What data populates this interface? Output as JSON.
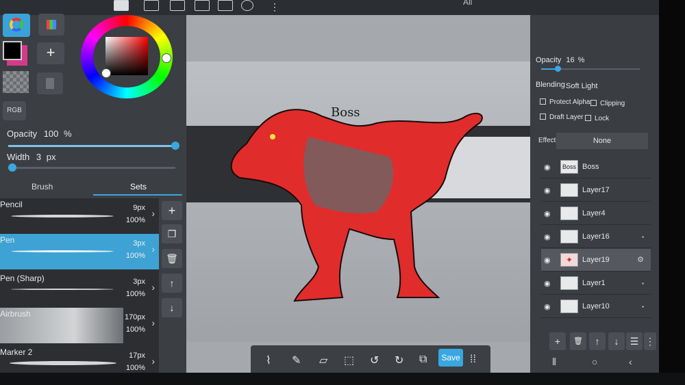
{
  "topbar": {
    "title": "All",
    "more": "⋮"
  },
  "color": {
    "primary": "#000000",
    "secondary": "#d43a8a",
    "wheel_selected": "#cc2f36",
    "rgb_label": "RGB",
    "add_label": "+"
  },
  "brush_panel": {
    "opacity_label": "Opacity",
    "opacity_value": "100",
    "opacity_unit": "%",
    "opacity_fraction": 1.0,
    "width_label": "Width",
    "width_value": "3",
    "width_unit": "px",
    "width_fraction": 0.02,
    "tabs": [
      {
        "label": "Brush"
      },
      {
        "label": "Sets"
      }
    ],
    "active_tab": "Sets",
    "brushes": [
      {
        "name": "Pencil",
        "size": "9px",
        "opacity": "100%"
      },
      {
        "name": "Pen",
        "size": "3px",
        "opacity": "100%"
      },
      {
        "name": "Pen (Sharp)",
        "size": "3px",
        "opacity": "100%"
      },
      {
        "name": "Airbrush",
        "size": "170px",
        "opacity": "100%"
      },
      {
        "name": "Marker 2",
        "size": "17px",
        "opacity": "100%"
      }
    ],
    "selected_brush": "Pen"
  },
  "canvas": {
    "boss_text": "Boss",
    "accent": "#e12c2c"
  },
  "bottom_toolbar": {
    "save_label": "Save"
  },
  "layers_panel": {
    "opacity_label": "Opacity",
    "opacity_value": "16",
    "opacity_unit": "%",
    "opacity_fraction": 0.16,
    "blending_label": "Blending",
    "blending_value": "Soft Light",
    "protect_alpha_label": "Protect Alpha",
    "clipping_label": "Clipping",
    "draft_layer_label": "Draft Layer",
    "lock_label": "Lock",
    "effect_label": "Effect",
    "effect_value": "None",
    "layers": [
      {
        "name": "Boss",
        "thumb": "Boss"
      },
      {
        "name": "Layer17",
        "thumb": ""
      },
      {
        "name": "Layer4",
        "thumb": ""
      },
      {
        "name": "Layer16",
        "thumb": ""
      },
      {
        "name": "Layer19",
        "thumb": ""
      },
      {
        "name": "Layer1",
        "thumb": ""
      },
      {
        "name": "Layer10",
        "thumb": ""
      }
    ],
    "selected_layer": "Layer19"
  }
}
